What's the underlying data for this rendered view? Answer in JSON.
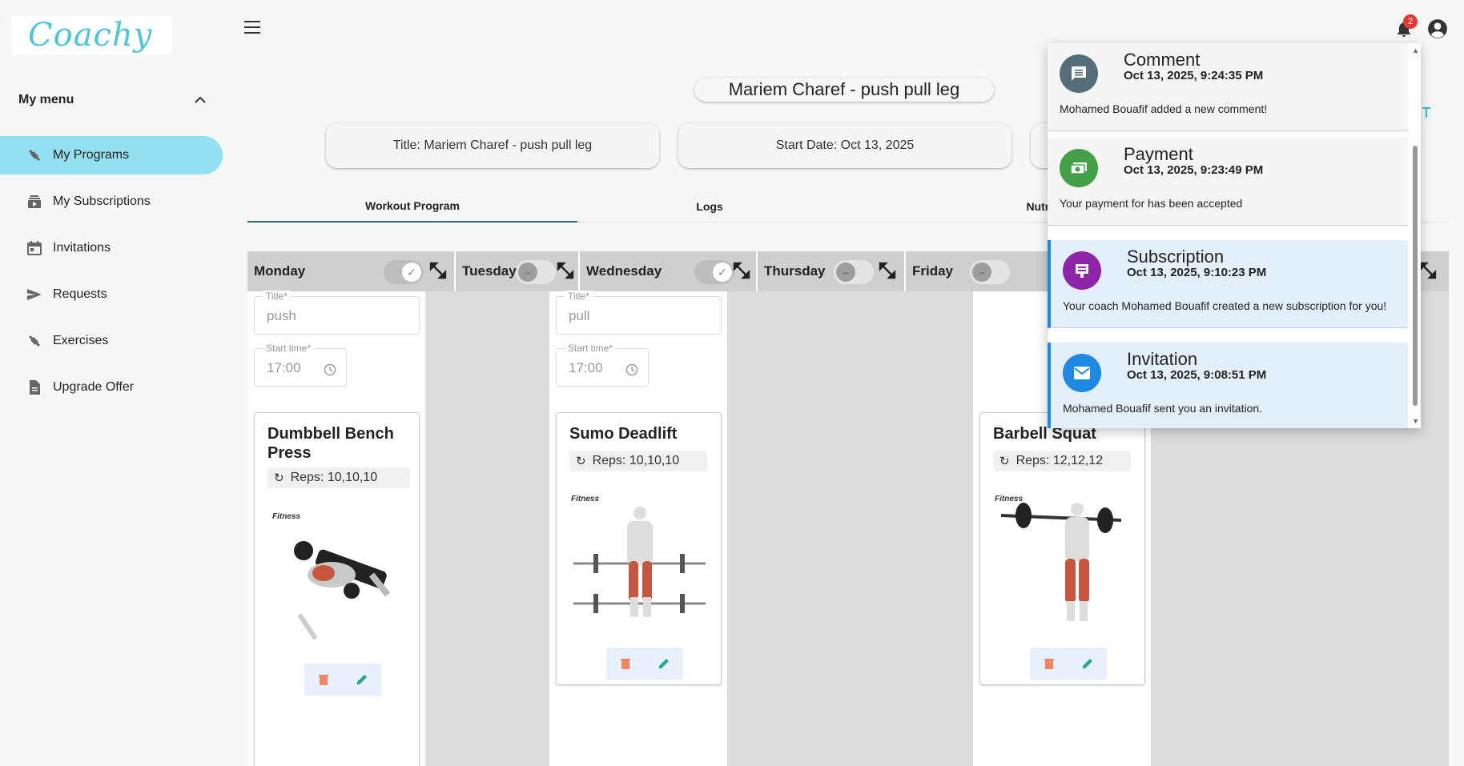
{
  "app": {
    "logo_text": "Coachy"
  },
  "sidebar": {
    "menu_title": "My menu",
    "items": [
      {
        "label": "My Programs",
        "icon": "dumbbell-icon",
        "active": true
      },
      {
        "label": "My Subscriptions",
        "icon": "subscriptions-icon"
      },
      {
        "label": "Invitations",
        "icon": "calendar-icon"
      },
      {
        "label": "Requests",
        "icon": "send-icon"
      },
      {
        "label": "Exercises",
        "icon": "dumbbell-icon"
      },
      {
        "label": "Upgrade Offer",
        "icon": "document-icon"
      }
    ]
  },
  "header": {
    "notification_count": "2"
  },
  "program": {
    "title": "Mariem Charef - push pull leg",
    "info_title": "Title: Mariem Charef - push pull leg",
    "info_start": "Start Date: Oct 13, 2025"
  },
  "tabs": [
    {
      "label": "Workout Program",
      "active": true
    },
    {
      "label": "Logs"
    },
    {
      "label": "Nutrition Plans"
    }
  ],
  "days": [
    {
      "name": "Monday",
      "enabled": true
    },
    {
      "name": "Tuesday",
      "enabled": false
    },
    {
      "name": "Wednesday",
      "enabled": true
    },
    {
      "name": "Thursday",
      "enabled": false
    },
    {
      "name": "Friday",
      "enabled": false
    }
  ],
  "sessions": {
    "monday": {
      "title_label": "Title*",
      "title_value": "push",
      "time_label": "Start time*",
      "time_value": "17:00"
    },
    "wednesday": {
      "title_label": "Title*",
      "title_value": "pull",
      "time_label": "Start time*",
      "time_value": "17:00"
    }
  },
  "exercises": [
    {
      "name_line1": "Dumbbell Bench",
      "name_line2": "Press",
      "reps": "Reps: 10,10,10"
    },
    {
      "name_line1": "Sumo Deadlift",
      "name_line2": "",
      "reps": "Reps: 10,10,10"
    },
    {
      "name_line1": "Barbell Squat",
      "name_line2": "",
      "reps": "Reps: 12,12,12"
    }
  ],
  "brand_tag": "Fitness",
  "notifications": [
    {
      "title": "Comment",
      "time": "Oct 13, 2025, 9:24:35 PM",
      "message": "Mohamed Bouafif added a new comment!",
      "color": "#546e7a",
      "icon": "comment-icon",
      "unread": false
    },
    {
      "title": "Payment",
      "time": "Oct 13, 2025, 9:23:49 PM",
      "message": "Your payment for has been accepted",
      "color": "#43a047",
      "icon": "payment-icon",
      "unread": false
    },
    {
      "title": "Subscription",
      "time": "Oct 13, 2025, 9:10:23 PM",
      "message": "Your coach Mohamed Bouafif created a new subscription for you!",
      "color": "#8e24aa",
      "icon": "subscription-icon",
      "unread": true
    },
    {
      "title": "Invitation",
      "time": "Oct 13, 2025, 9:08:51 PM",
      "message": "Mohamed Bouafif sent you an invitation.",
      "color": "#1e88e5",
      "icon": "mail-icon",
      "unread": true
    }
  ],
  "colors": {
    "accent": "#92e0f0",
    "tab_indicator": "#2a6b74",
    "delete": "#f4845f",
    "edit": "#26a69a"
  }
}
